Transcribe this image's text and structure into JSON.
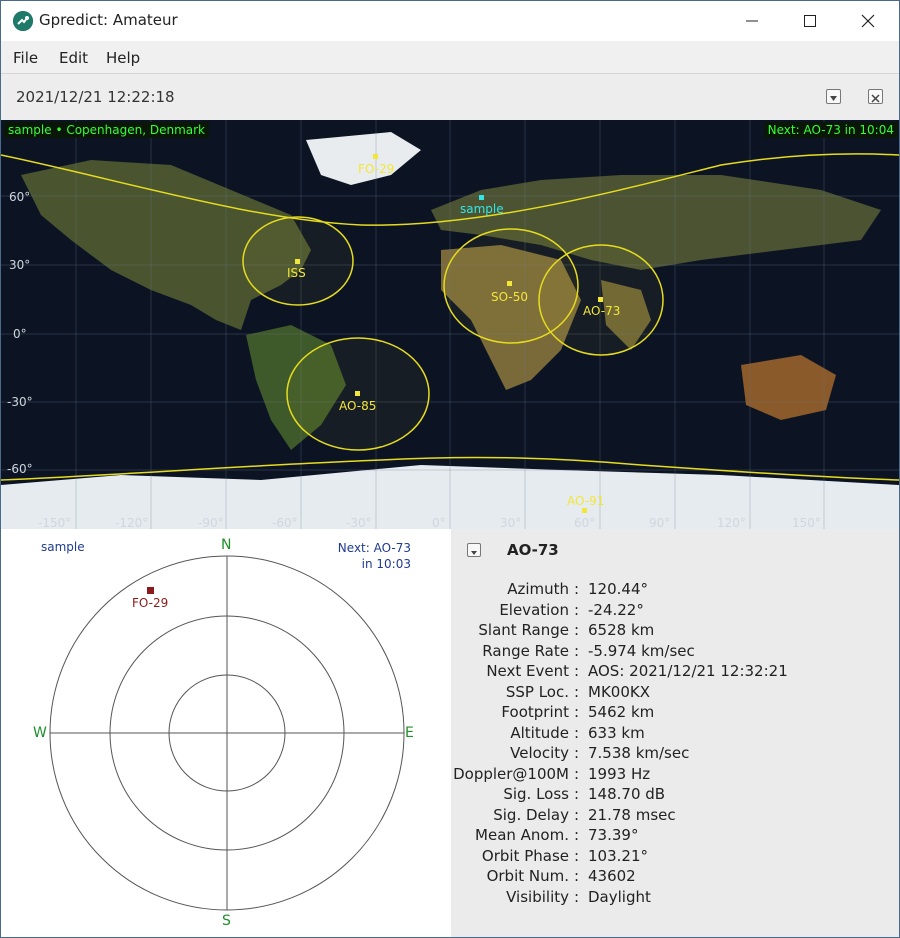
{
  "window": {
    "title": "Gpredict: Amateur"
  },
  "menu": {
    "items": [
      "File",
      "Edit",
      "Help"
    ]
  },
  "module": {
    "time": "2021/12/21 12:22:18"
  },
  "map": {
    "location_label": "sample • Copenhagen, Denmark",
    "next_label": "Next: AO-73 in 10:04",
    "qth_name": "sample",
    "satellites": [
      "FO-29",
      "ISS",
      "SO-50",
      "AO-73",
      "AO-85",
      "AO-91"
    ],
    "lat_labels": [
      "60°",
      "30°",
      "0°",
      "-30°",
      "-60°"
    ],
    "lon_labels": [
      "-150°",
      "-120°",
      "-90°",
      "-60°",
      "-30°",
      "0°",
      "30°",
      "60°",
      "90°",
      "120°",
      "150°"
    ],
    "colors": {
      "footprint": "#e6dc1f",
      "satellite": "#f3e63a",
      "qth": "#33e6e6",
      "info": "#33ff33"
    }
  },
  "polar": {
    "qth_name": "sample",
    "next_line1": "Next: AO-73",
    "next_line2": "in 10:03",
    "compass": {
      "n": "N",
      "s": "S",
      "e": "E",
      "w": "W"
    },
    "satellite": "FO-29"
  },
  "details": {
    "satellite": "AO-73",
    "rows": [
      {
        "label": "Azimuth",
        "value": "120.44°"
      },
      {
        "label": "Elevation",
        "value": "-24.22°"
      },
      {
        "label": "Slant Range",
        "value": "6528 km"
      },
      {
        "label": "Range Rate",
        "value": "-5.974 km/sec"
      },
      {
        "label": "Next Event",
        "value": "AOS: 2021/12/21 12:32:21"
      },
      {
        "label": "SSP Loc.",
        "value": "MK00KX"
      },
      {
        "label": "Footprint",
        "value": "5462 km"
      },
      {
        "label": "Altitude",
        "value": "633 km"
      },
      {
        "label": "Velocity",
        "value": "7.538 km/sec"
      },
      {
        "label": "Doppler@100M",
        "value": "1993 Hz"
      },
      {
        "label": "Sig. Loss",
        "value": "148.70 dB"
      },
      {
        "label": "Sig. Delay",
        "value": "21.78 msec"
      },
      {
        "label": "Mean Anom.",
        "value": "73.39°"
      },
      {
        "label": "Orbit Phase",
        "value": "103.21°"
      },
      {
        "label": "Orbit Num.",
        "value": "43602"
      },
      {
        "label": "Visibility",
        "value": "Daylight"
      }
    ]
  }
}
